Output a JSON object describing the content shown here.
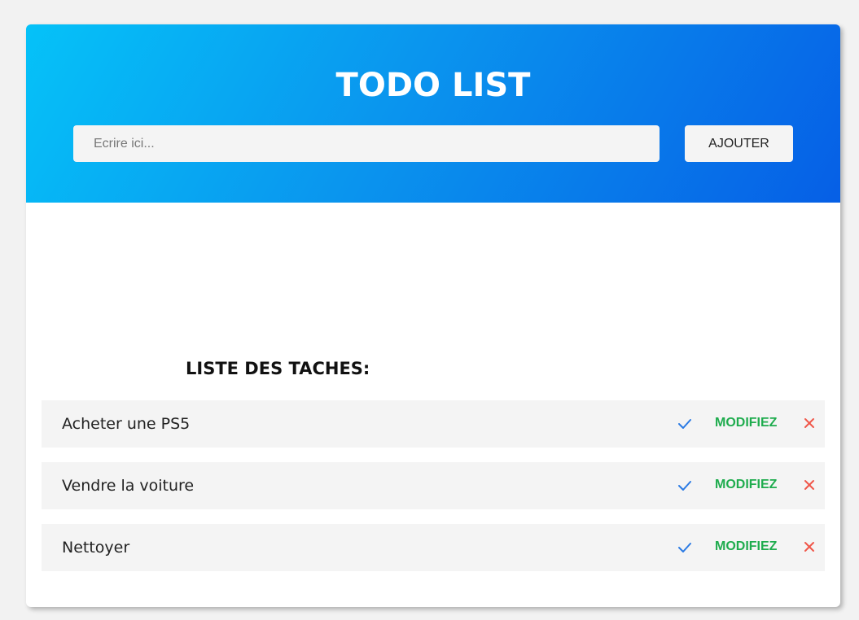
{
  "header": {
    "title": "TODO LIST",
    "input_placeholder": "Ecrire ici...",
    "input_value": "",
    "add_label": "AJOUTER"
  },
  "list": {
    "heading": "LISTE DES TACHES:",
    "tasks": [
      {
        "text": "Acheter une PS5",
        "edit_label": "MODIFIEZ",
        "complete_icon": "check-icon",
        "delete_icon": "close-icon"
      },
      {
        "text": "Vendre la voiture",
        "edit_label": "MODIFIEZ",
        "complete_icon": "check-icon",
        "delete_icon": "close-icon"
      },
      {
        "text": "Nettoyer",
        "edit_label": "MODIFIEZ",
        "complete_icon": "check-icon",
        "delete_icon": "close-icon"
      }
    ]
  },
  "colors": {
    "header_gradient_start": "#05c2f8",
    "header_gradient_end": "#065fe6",
    "check": "#2a7ae4",
    "edit": "#1fac4e",
    "delete": "#f0574a",
    "row_background": "#f4f4f4",
    "page_background": "#f2f2f2"
  }
}
